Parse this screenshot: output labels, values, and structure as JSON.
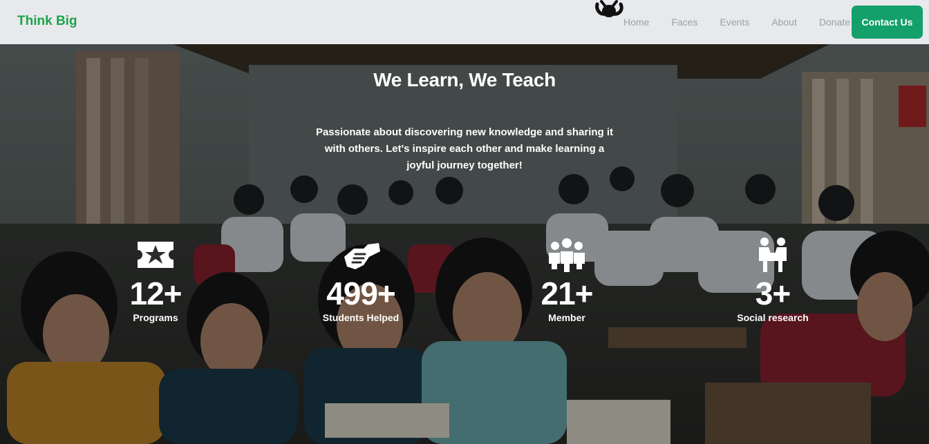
{
  "brand": {
    "name": "Think Big",
    "color": "#1ea34a"
  },
  "nav": {
    "links": [
      {
        "label": "Home"
      },
      {
        "label": "Faces"
      },
      {
        "label": "Events"
      },
      {
        "label": "About"
      },
      {
        "label": "Donate"
      }
    ],
    "cta_label": "Contact Us",
    "cta_color": "#14a06a"
  },
  "hero": {
    "title": "We Learn, We Teach",
    "subtitle": "Passionate about discovering new knowledge and sharing it with others. Let's inspire each other and make learning a joyful journey together!",
    "background_image": "classroom-students-photo"
  },
  "stats": [
    {
      "icon": "ticket-star-icon",
      "value": "12+",
      "label": "Programs"
    },
    {
      "icon": "handshake-icon",
      "value": "499+",
      "label": "Students Helped"
    },
    {
      "icon": "group-people-icon",
      "value": "21+",
      "label": "Member"
    },
    {
      "icon": "people-table-icon",
      "value": "3+",
      "label": "Social research"
    }
  ]
}
